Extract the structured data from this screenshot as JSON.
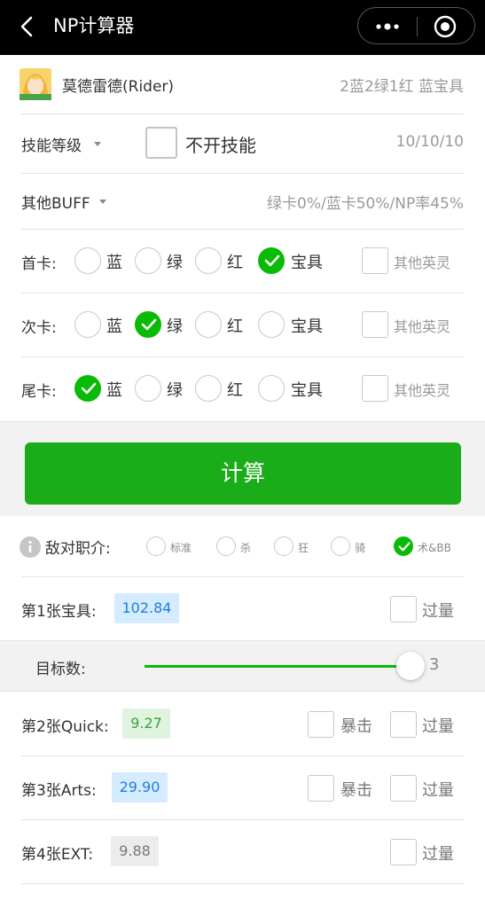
{
  "nav": {
    "title": "NP计算器"
  },
  "servant": {
    "name": "莫德雷德(Rider)",
    "deck": "2蓝2绿1红 蓝宝具"
  },
  "skill": {
    "label": "技能等级",
    "toggle_label": "不开技能",
    "levels": "10/10/10"
  },
  "buff": {
    "label": "其他BUFF",
    "summary": "绿卡0%/蓝卡50%/NP率45%"
  },
  "cards": [
    {
      "label": "首卡:",
      "selected": "宝具",
      "other_label": "其他英灵"
    },
    {
      "label": "次卡:",
      "selected": "绿",
      "other_label": "其他英灵"
    },
    {
      "label": "尾卡:",
      "selected": "蓝",
      "other_label": "其他英灵"
    }
  ],
  "card_options": [
    "蓝",
    "绿",
    "红",
    "宝具"
  ],
  "calc_button": "计算",
  "enemy_class": {
    "label": "敌对职介:",
    "options": [
      "标准",
      "杀",
      "狂",
      "骑",
      "术&BB"
    ],
    "selected": "术&BB"
  },
  "results": [
    {
      "label": "第1张宝具:",
      "value": "102.84",
      "overkill_label": "过量"
    },
    {
      "label": "第2张Quick:",
      "value": "9.27",
      "crit_label": "暴击",
      "overkill_label": "过量"
    },
    {
      "label": "第3张Arts:",
      "value": "29.90",
      "crit_label": "暴击",
      "overkill_label": "过量"
    },
    {
      "label": "第4张EXT:",
      "value": "9.88",
      "overkill_label": "过量"
    }
  ],
  "targets": {
    "label": "目标数:",
    "value": "3",
    "fraction": 1.0
  },
  "colors": {
    "accent": "#09bb07",
    "button": "#1aad19",
    "navbar": "#000000"
  }
}
